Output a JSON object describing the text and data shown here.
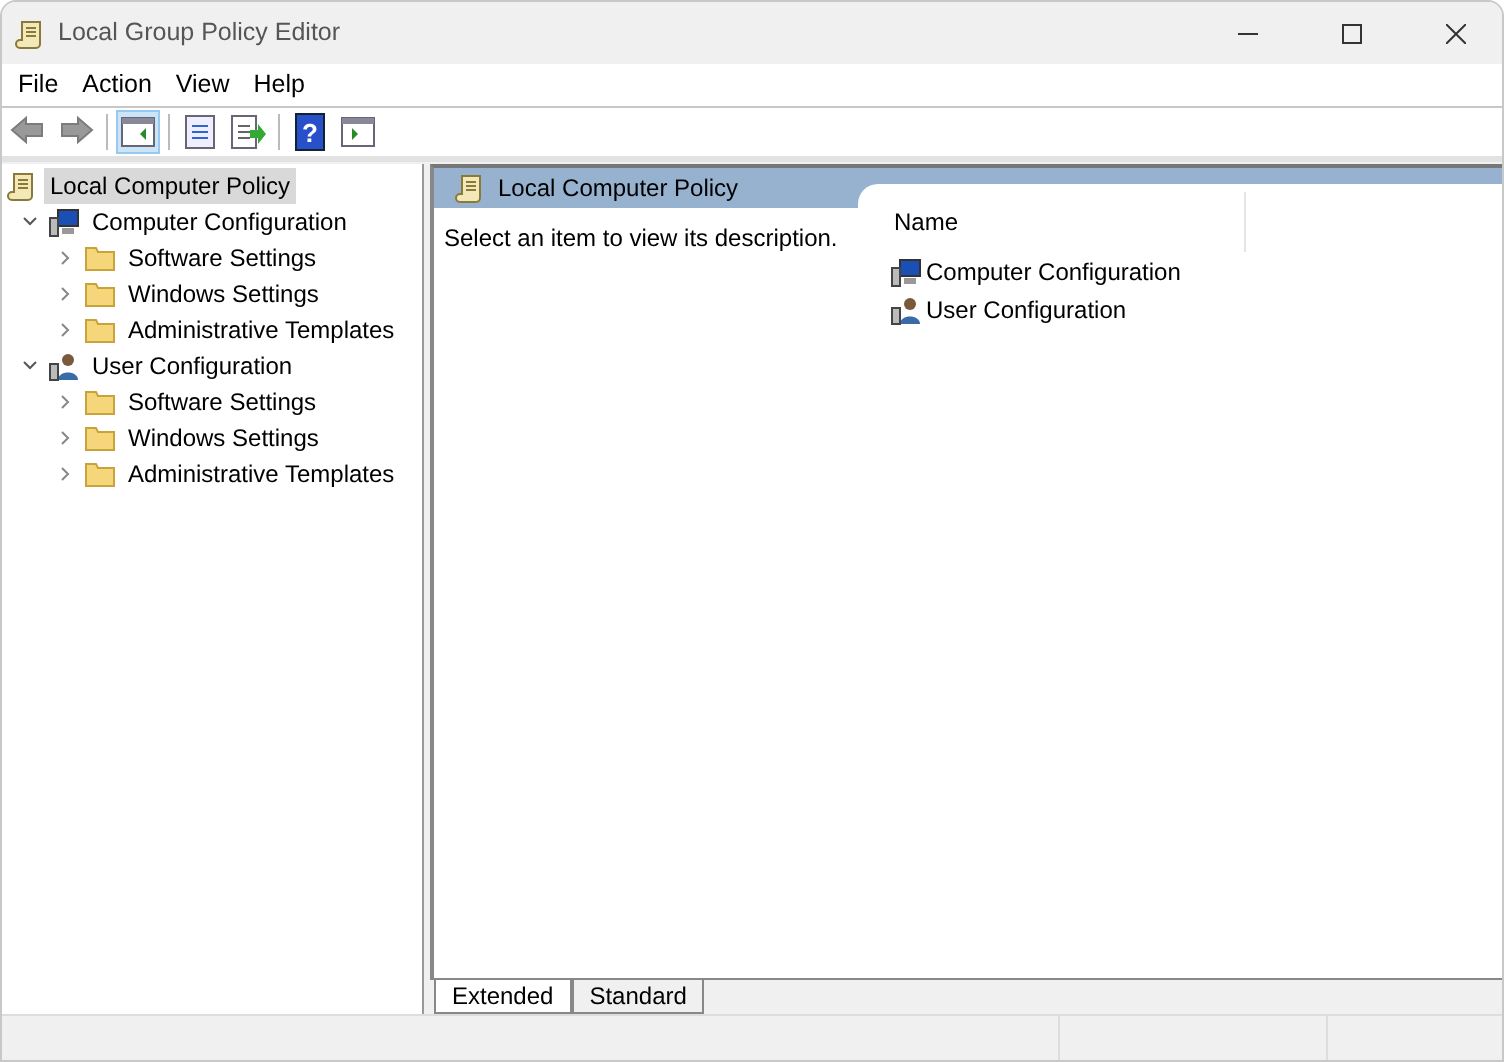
{
  "window": {
    "title": "Local Group Policy Editor"
  },
  "menu": [
    "File",
    "Action",
    "View",
    "Help"
  ],
  "toolbar": [
    {
      "kind": "back",
      "disabled": true
    },
    {
      "kind": "forward",
      "disabled": true
    },
    {
      "kind": "sep"
    },
    {
      "kind": "tree-toggle",
      "selected": true
    },
    {
      "kind": "sep"
    },
    {
      "kind": "properties",
      "selected": false
    },
    {
      "kind": "export",
      "selected": false
    },
    {
      "kind": "sep"
    },
    {
      "kind": "help",
      "selected": false,
      "glyph": "?"
    },
    {
      "kind": "action-pane",
      "selected": false
    }
  ],
  "tree": [
    {
      "label": "Local Computer Policy",
      "kind": "policy",
      "selected": true,
      "children": [
        {
          "label": "Computer Configuration",
          "kind": "computer",
          "selected": false,
          "expanded": true,
          "children": [
            {
              "label": "Software Settings",
              "kind": "folder",
              "selected": false,
              "expanded": false
            },
            {
              "label": "Windows Settings",
              "kind": "folder",
              "selected": false,
              "expanded": false
            },
            {
              "label": "Administrative Templates",
              "kind": "folder",
              "selected": false,
              "expanded": false
            }
          ]
        },
        {
          "label": "User Configuration",
          "kind": "user",
          "selected": false,
          "expanded": true,
          "children": [
            {
              "label": "Software Settings",
              "kind": "folder",
              "selected": false,
              "expanded": false
            },
            {
              "label": "Windows Settings",
              "kind": "folder",
              "selected": false,
              "expanded": false
            },
            {
              "label": "Administrative Templates",
              "kind": "folder",
              "selected": false,
              "expanded": false
            }
          ]
        }
      ]
    }
  ],
  "detail": {
    "header": "Local Computer Policy",
    "description": "Select an item to view its description.",
    "column": "Name",
    "items": [
      {
        "label": "Computer Configuration",
        "kind": "computer"
      },
      {
        "label": "User Configuration",
        "kind": "user"
      }
    ]
  },
  "tabs": [
    {
      "label": "Extended",
      "selected": true
    },
    {
      "label": "Standard",
      "selected": false
    }
  ]
}
